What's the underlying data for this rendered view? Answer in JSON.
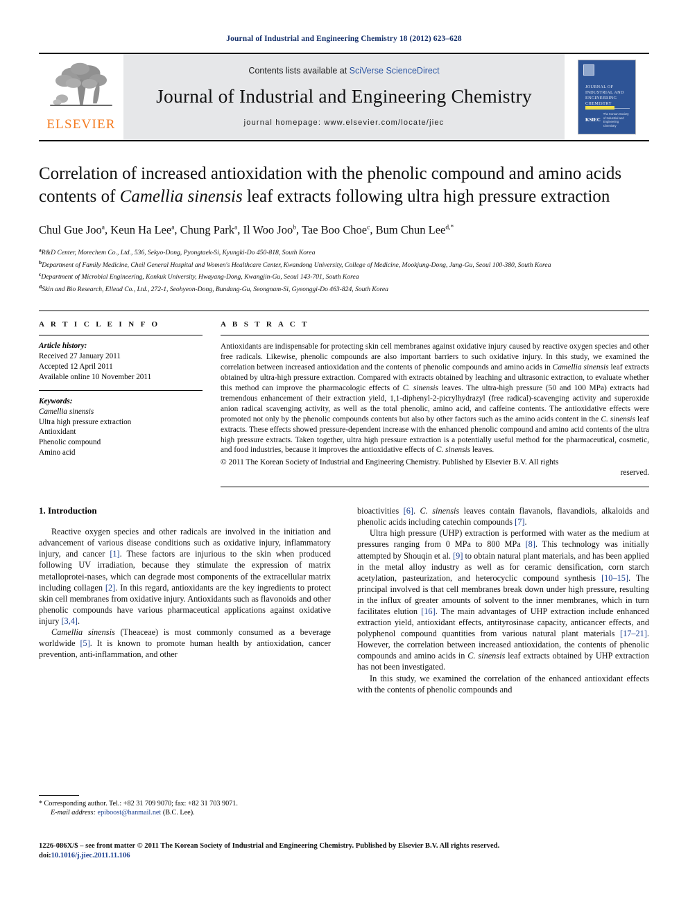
{
  "running_head": "Journal of Industrial and Engineering Chemistry 18 (2012) 623–628",
  "masthead": {
    "contents_prefix": "Contents lists available at ",
    "sciencedirect": "SciVerse ScienceDirect",
    "journal_title": "Journal of Industrial and Engineering Chemistry",
    "homepage": "journal homepage: www.elsevier.com/locate/jiec",
    "publisher_logo_text": "ELSEVIER",
    "cover": {
      "title_lines": "JOURNAL OF INDUSTRIAL AND ENGINEERING CHEMISTRY",
      "society_mark": "KSIEC",
      "society_text": "The Korean Society of Industrial and Engineering Chemistry"
    }
  },
  "article": {
    "title_part1": "Correlation of increased antioxidation with the phenolic compound and amino acids contents of ",
    "title_italic": "Camellia sinensis",
    "title_part2": " leaf extracts following ultra high pressure extraction",
    "authors": [
      {
        "name": "Chul Gue Joo",
        "sup": "a",
        "sep": ", "
      },
      {
        "name": "Keun Ha Lee",
        "sup": "a",
        "sep": ", "
      },
      {
        "name": "Chung Park",
        "sup": "a",
        "sep": ", "
      },
      {
        "name": "Il Woo Joo",
        "sup": "b",
        "sep": ", "
      },
      {
        "name": "Tae Boo Choe",
        "sup": "c",
        "sep": ", "
      },
      {
        "name": "Bum Chun Lee",
        "sup": "d,*",
        "sep": ""
      }
    ],
    "affiliations": [
      {
        "marker": "a",
        "text": "R&D Center, Morechem Co., Ltd., 536, Sekyo-Dong, Pyongtaek-Si, Kyungki-Do 450-818, South Korea"
      },
      {
        "marker": "b",
        "text": "Department of Family Medicine, Cheil General Hospital and Women's Healthcare Center, Kwandong University, College of Medicine, Mookjung-Dong, Jung-Gu, Seoul 100-380, South Korea"
      },
      {
        "marker": "c",
        "text": "Department of Microbial Engineering, Konkuk University, Hwayang-Dong, Kwangjin-Gu, Seoul 143-701, South Korea"
      },
      {
        "marker": "d",
        "text": "Skin and Bio Research, Ellead Co., Ltd., 272-1, Seohyeon-Dong, Bundang-Gu, Seongnam-Si, Gyeonggi-Do 463-824, South Korea"
      }
    ]
  },
  "article_info": {
    "label": "A R T I C L E  I N F O",
    "history_head": "Article history:",
    "history": [
      "Received 27 January 2011",
      "Accepted 12 April 2011",
      "Available online 10 November 2011"
    ],
    "keywords_head": "Keywords:",
    "keywords": [
      "Camellia sinensis",
      "Ultra high pressure extraction",
      "Antioxidant",
      "Phenolic compound",
      "Amino acid"
    ]
  },
  "abstract": {
    "label": "A B S T R A C T",
    "p1": "Antioxidants are indispensable for protecting skin cell membranes against oxidative injury caused by reactive oxygen species and other free radicals. Likewise, phenolic compounds are also important barriers to such oxidative injury. In this study, we examined the correlation between increased antioxidation and the contents of phenolic compounds and amino acids in ",
    "sci1": "Camellia sinensis",
    "p2": " leaf extracts obtained by ultra-high pressure extraction. Compared with extracts obtained by leaching and ultrasonic extraction, to evaluate whether this method can improve the pharmacologic effects of ",
    "sci2": "C. sinensis",
    "p3": " leaves. The ultra-high pressure (50 and 100 MPa) extracts had tremendous enhancement of their extraction yield, 1,1-diphenyl-2-picrylhydrazyl (free radical)-scavenging activity and superoxide anion radical scavenging activity, as well as the total phenolic, amino acid, and caffeine contents. The antioxidative effects were promoted not only by the phenolic compounds contents but also by other factors such as the amino acids content in the ",
    "sci3": "C. sinensis",
    "p4": " leaf extracts. These effects showed pressure-dependent increase with the enhanced phenolic compound and amino acid contents of the ultra high pressure extracts. Taken together, ultra high pressure extraction is a potentially useful method for the pharmaceutical, cosmetic, and food industries, because it improves the antioxidative effects of ",
    "sci4": "C. sinensis",
    "p5": " leaves.",
    "copyright": "© 2011 The Korean Society of Industrial and Engineering Chemistry. Published by Elsevier B.V. All rights",
    "copyright_tail": "reserved."
  },
  "body": {
    "section_number_title": "1. Introduction",
    "left_column": {
      "para1_a": "Reactive oxygen species and other radicals are involved in the initiation and advancement of various disease conditions such as oxidative injury, inflammatory injury, and cancer ",
      "ref1": "[1]",
      "para1_b": ". These factors are injurious to the skin when produced following UV irradiation, because they stimulate the expression of matrix metalloprotei-nases, which can degrade most components of the extracellular matrix including collagen ",
      "ref2": "[2]",
      "para1_c": ". In this regard, antioxidants are the key ingredients to protect skin cell membranes from oxidative injury. Antioxidants such as flavonoids and other phenolic compounds have various pharmaceutical applications against oxidative injury ",
      "ref3": "[3,4]",
      "para1_d": ".",
      "para2_sci": "Camellia sinensis",
      "para2_a": " (Theaceae) is most commonly consumed as a beverage worldwide ",
      "ref4": "[5]",
      "para2_b": ". It is known to promote human health by antioxidation, cancer prevention, anti-inflammation, and other"
    },
    "right_column": {
      "cont_a": "bioactivities ",
      "ref6": "[6]",
      "cont_b": ". ",
      "cont_sci": "C. sinensis",
      "cont_c": " leaves contain flavanols, flavandiols, alkaloids and phenolic acids including catechin compounds ",
      "ref7": "[7]",
      "cont_d": ".",
      "para3_a": "Ultra high pressure (UHP) extraction is performed with water as the medium at pressures ranging from 0 MPa to 800 MPa ",
      "ref8": "[8]",
      "para3_b": ". This technology was initially attempted by Shouqin et al. ",
      "ref9": "[9]",
      "para3_c": " to obtain natural plant materials, and has been applied in the metal alloy industry as well as for ceramic densification, corn starch acetylation, pasteurization, and heterocyclic compound synthesis ",
      "ref10": "[10–15]",
      "para3_d": ". The principal involved is that cell membranes break down under high pressure, resulting in the influx of greater amounts of solvent to the inner membranes, which in turn facilitates elution ",
      "ref16": "[16]",
      "para3_e": ". The main advantages of UHP extraction include enhanced extraction yield, antioxidant effects, antityrosinase capacity, anticancer effects, and polyphenol compound quantities from various natural plant materials ",
      "ref17": "[17–21]",
      "para3_f": ". However, the correlation between increased antioxidation, the contents of phenolic compounds and amino acids in ",
      "para3_sci": "C. sinensis",
      "para3_g": " leaf extracts obtained by UHP extraction has not been investigated.",
      "para4": "In this study, we examined the correlation of the enhanced antioxidant effects with the contents of phenolic compounds and"
    }
  },
  "footnotes": {
    "corresponding": "Corresponding author. Tel.: +82 31 709 9070; fax: +82 31 703 9071.",
    "email_label": "E-mail address:",
    "email": "epiboost@hanmail.net",
    "email_owner": " (B.C. Lee)."
  },
  "page_footer": {
    "line1": "1226-086X/$ – see front matter © 2011 The Korean Society of Industrial and Engineering Chemistry. Published by Elsevier B.V. All rights reserved.",
    "doi_label": "doi:",
    "doi": "10.1016/j.jiec.2011.11.106"
  },
  "colors": {
    "running_head": "#15306b",
    "link": "#2b55a3",
    "reference": "#1b3f8f",
    "elsevier_orange": "#f47b20",
    "masthead_grey": "#e6e7e9",
    "cover_blue": "#2e5496",
    "cover_accent": "#f2e14c"
  }
}
